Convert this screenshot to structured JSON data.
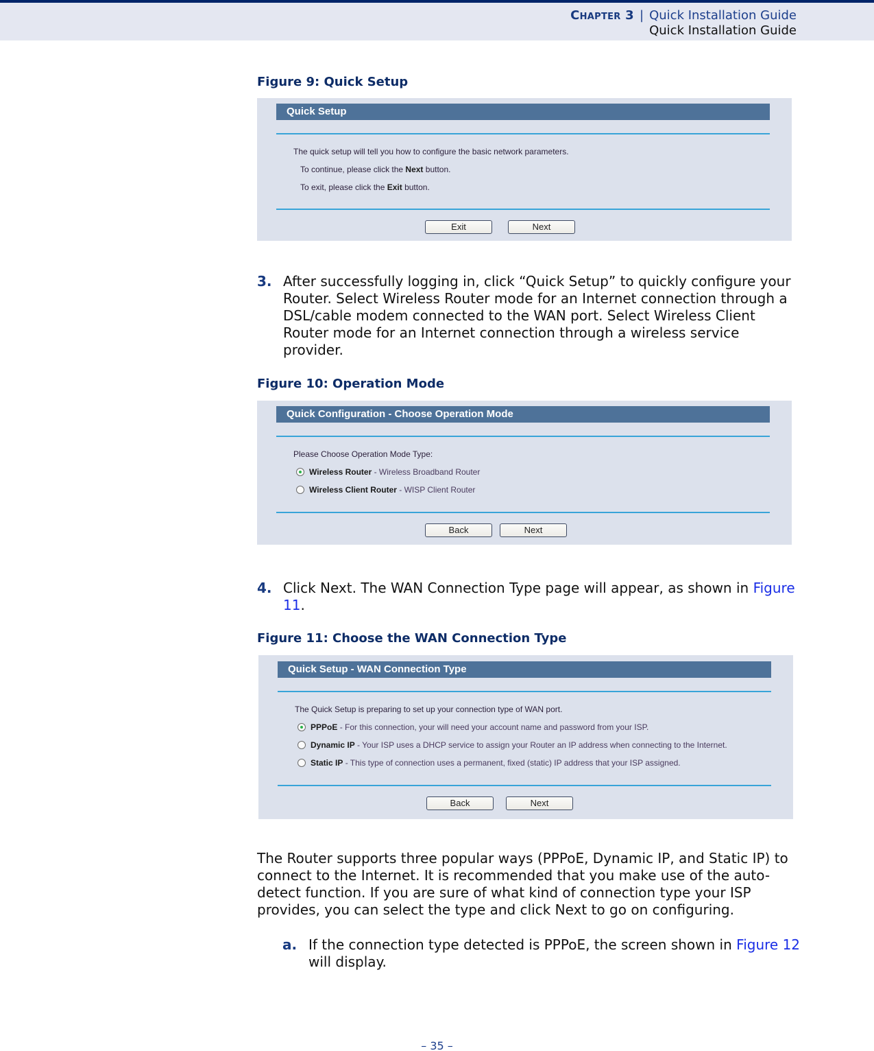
{
  "header": {
    "chapter_label": "Chapter 3",
    "separator": "|",
    "chapter_title": "Quick Installation Guide",
    "section_title": "Quick Installation Guide"
  },
  "figure9": {
    "caption": "Figure 9:  Quick Setup",
    "panel_title": "Quick Setup",
    "line1": "The quick setup will tell you how to configure the basic network parameters.",
    "line2_pre": "To continue, please click the ",
    "line2_bold": "Next",
    "line2_post": " button.",
    "line3_pre": "To exit, please click the ",
    "line3_bold": "Exit",
    "line3_post": " button.",
    "buttons": {
      "exit": "Exit",
      "next": "Next"
    }
  },
  "step3": {
    "number": "3.",
    "text": "After successfully logging in, click “Quick Setup” to quickly configure your Router. Select Wireless Router mode for an Internet connection through a DSL/cable modem connected to the WAN port. Select Wireless Client Router mode for an Internet connection through a wireless service provider."
  },
  "figure10": {
    "caption": "Figure 10:  Operation Mode",
    "panel_title": "Quick Configuration - Choose Operation Mode",
    "prompt": "Please Choose Operation Mode Type:",
    "options": [
      {
        "label": "Wireless Router",
        "desc": " - Wireless Broadband Router",
        "selected": true
      },
      {
        "label": "Wireless Client Router",
        "desc": " - WISP Client Router",
        "selected": false
      }
    ],
    "buttons": {
      "back": "Back",
      "next": "Next"
    }
  },
  "step4": {
    "number": "4.",
    "text_pre": "Click Next. The WAN Connection Type page will appear, as shown in ",
    "link": "Figure 11",
    "text_post": "."
  },
  "figure11": {
    "caption": "Figure 11:  Choose the WAN Connection Type",
    "panel_title": "Quick Setup - WAN Connection Type",
    "prompt": "The Quick Setup is preparing to set up your connection type of WAN port.",
    "options": [
      {
        "label": "PPPoE",
        "desc": " - For this connection, your will need your account name and password from your ISP.",
        "selected": true
      },
      {
        "label": "Dynamic IP",
        "desc": " - Your ISP uses a DHCP service to assign your Router an IP address when connecting to the Internet.",
        "selected": false
      },
      {
        "label": "Static IP",
        "desc": " - This type of connection uses a permanent, fixed (static) IP address that your ISP assigned.",
        "selected": false
      }
    ],
    "buttons": {
      "back": "Back",
      "next": "Next"
    }
  },
  "paragraph": "The Router supports three popular ways (PPPoE, Dynamic IP, and Static IP) to connect to the Internet. It is recommended that you make use of the auto-detect function. If you are sure of what kind of connection type your ISP provides, you can select the type and click Next to go on configuring.",
  "step_a": {
    "number": "a.",
    "text_pre": "If the connection type detected is PPPoE, the screen shown in ",
    "link": "Figure 12",
    "text_post": " will display."
  },
  "footer": {
    "page_number": "–  35  –"
  },
  "colors": {
    "brand_navy": "#002469",
    "panel_header": "#4e7299",
    "panel_bg": "#dce1ec",
    "rule_blue": "#38a4d8",
    "link_blue": "#1a2ee6"
  }
}
